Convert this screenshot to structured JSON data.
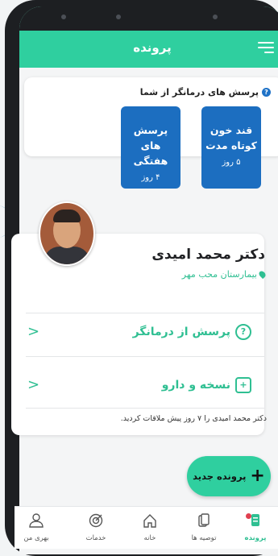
{
  "header": {
    "title": "پرونده"
  },
  "questions": {
    "heading": "پرسش های درمانگر از شما",
    "tiles": [
      {
        "title": "قند خون کوتاه مدت",
        "duration": "۵ روز"
      },
      {
        "title": "پرسش های هفتگی",
        "duration": "۴ روز"
      }
    ]
  },
  "doctor": {
    "name": "دکتر محمد امیدی",
    "location": "بیمارستان محب مهر",
    "actions": [
      {
        "label": "پرسش از درمانگر"
      },
      {
        "label": "نسخه و دارو"
      }
    ],
    "last_visit": "دکتر محمد امیدی را ۷ روز پیش ملاقات کردید."
  },
  "fab": {
    "label": "پرونده جدید",
    "icon": "plus-icon"
  },
  "bottom_nav": {
    "items": [
      {
        "label": "پرونده",
        "icon": "file-icon",
        "active": true
      },
      {
        "label": "توصیه ها",
        "icon": "document-copy-icon",
        "active": false
      },
      {
        "label": "خانه",
        "icon": "home-icon",
        "active": false
      },
      {
        "label": "خدمات",
        "icon": "target-icon",
        "active": false
      },
      {
        "label": "بهری من",
        "icon": "user-icon",
        "active": false
      }
    ]
  },
  "colors": {
    "accent": "#2fcf9f",
    "tile_blue": "#1c6ec0",
    "alert": "#e04050"
  }
}
